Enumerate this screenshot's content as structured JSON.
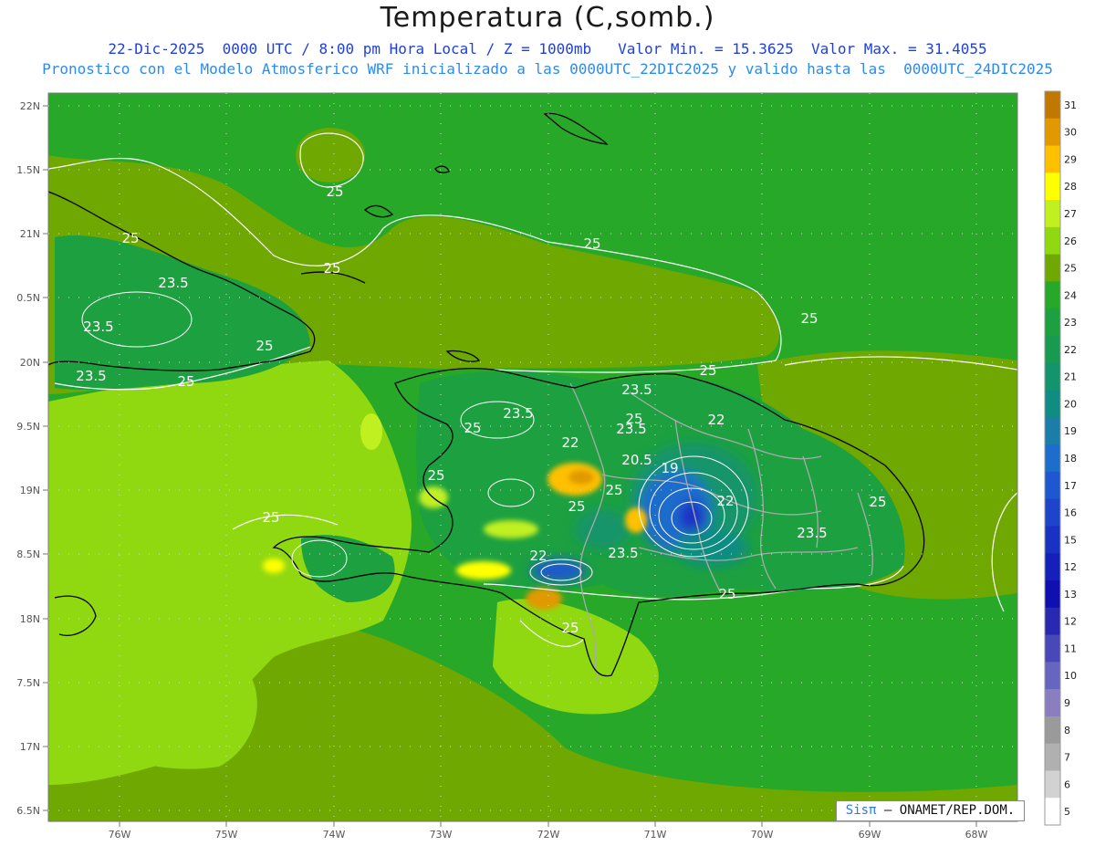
{
  "header": {
    "title": "Temperatura (C,somb.)",
    "line1": "22-Dic-2025  0000 UTC / 8:00 pm Hora Local / Z = 1000mb   Valor Min. = 15.3625  Valor Max. = 31.4055",
    "line2": "Pronostico con el Modelo Atmosferico WRF inicializado a las 0000UTC_22DIC2025 y valido hasta las  0000UTC_24DIC2025"
  },
  "axes": {
    "lat_labels": [
      "22N",
      "1.5N",
      "21N",
      "0.5N",
      "20N",
      "9.5N",
      "19N",
      "8.5N",
      "18N",
      "7.5N",
      "17N",
      "6.5N"
    ],
    "lon_labels": [
      "76W",
      "75W",
      "74W",
      "73W",
      "72W",
      "71W",
      "70W",
      "69W",
      "68W"
    ]
  },
  "colorbar": {
    "labels": [
      "31",
      "30",
      "29",
      "28",
      "27",
      "26",
      "25",
      "24",
      "23",
      "22",
      "21",
      "20",
      "19",
      "18",
      "17",
      "16",
      "15",
      "12",
      "13",
      "12",
      "11",
      "10",
      "9",
      "8",
      "7",
      "6",
      "5"
    ],
    "colors": [
      "#c07800",
      "#e09a00",
      "#ffc000",
      "#ffff00",
      "#c0f020",
      "#90d810",
      "#6ea800",
      "#28a828",
      "#1ca040",
      "#189a50",
      "#14946a",
      "#108c82",
      "#1a7ea8",
      "#1e6ccc",
      "#1e58d0",
      "#1e44cc",
      "#1a32c4",
      "#1420b8",
      "#1010b0",
      "#2828b0",
      "#4848b8",
      "#6666c0",
      "#8a7ec0",
      "#9a9a9a",
      "#b0b0b0",
      "#d2d2d2",
      "#ffffff"
    ]
  },
  "contour_labels": [
    "25",
    "25",
    "25",
    "25",
    "25",
    "23.5",
    "23.5",
    "23.5",
    "25",
    "25",
    "25",
    "23.5",
    "25",
    "23.5",
    "25",
    "22",
    "23.5",
    "20.5",
    "19",
    "25",
    "22",
    "22",
    "25",
    "25",
    "25",
    "23.5",
    "25",
    "22",
    "23.5",
    "25",
    "25"
  ],
  "footer": {
    "brand": "Sisπ",
    "credit": "– ONAMET/REP.DOM."
  }
}
